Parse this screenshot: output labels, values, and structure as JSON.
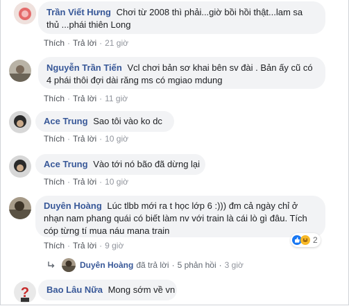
{
  "comments": [
    {
      "author": "Trần Viết Hưng",
      "text": "Chơi từ 2008 thì phải...giờ bồi hồi thật...lam sa thủ ...phái thiên Long",
      "like": "Thích",
      "reply": "Trả lời",
      "time": "21 giờ"
    },
    {
      "author": "Nguyễn Trần Tiến",
      "text": "Vcl chơi bản sơ khai bên sv đài . Bản ấy cũ có 4 phái thôi đợi dài răng ms có mgiao mdung",
      "like": "Thích",
      "reply": "Trả lời",
      "time": "11 giờ"
    },
    {
      "author": "Ace Trung",
      "text": "Sao tôi vào ko dc",
      "like": "Thích",
      "reply": "Trả lời",
      "time": "10 giờ"
    },
    {
      "author": "Ace Trung",
      "text": "Vào tới nó bão đã dừng lại",
      "like": "Thích",
      "reply": "Trả lời",
      "time": "10 giờ"
    },
    {
      "author": "Duyên Hoàng",
      "text": "Lúc tlbb mới ra t học lớp 6 :))) đm cả ngày chỉ ở nhạn nam phang quái có biết làm nv với train là cái lò gì đâu. Tích cóp từng tí mua náu mana train",
      "like": "Thích",
      "reply": "Trả lời",
      "time": "9 giờ",
      "reaction_count": "2"
    },
    {
      "author": "Bao Lâu Nữa",
      "text": "Mong sớm về vn"
    }
  ],
  "reply_preview": {
    "name": "Duyên Hoàng",
    "action": "đã trả lời",
    "replies": "5 phản hồi",
    "time": "3 giờ"
  },
  "colors": {
    "author": "#385898",
    "bubble": "#f2f3f5",
    "like": "#1877f2",
    "haha": "#f7b928"
  }
}
